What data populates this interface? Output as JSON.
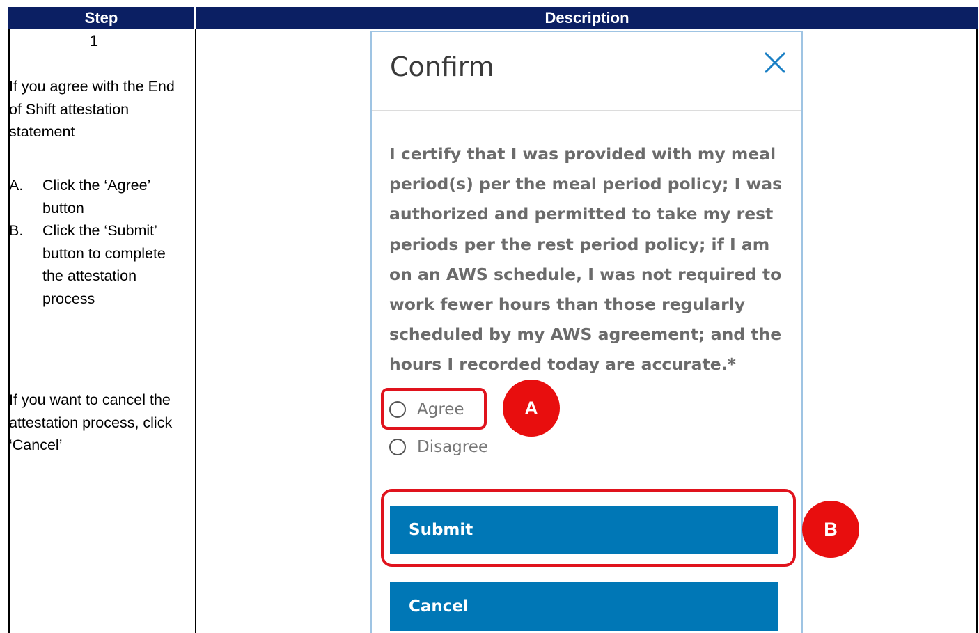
{
  "table": {
    "headers": {
      "step": "Step",
      "description": "Description"
    },
    "step_number": "1",
    "instructions": {
      "intro": "If you agree with the End of Shift attestation statement",
      "items": [
        {
          "letter": "A.",
          "text": "Click the ‘Agree’ button"
        },
        {
          "letter": "B.",
          "text": "Click the ‘Submit’ button to complete the attestation process"
        }
      ],
      "cancel_note": "If you want to cancel the attestation process, click ‘Cancel’"
    }
  },
  "modal": {
    "title": "Confirm",
    "statement": "I certify that I was provided with my meal period(s) per the meal period policy; I was authorized and permitted to take my rest periods per the rest period policy; if I am on an AWS schedule, I was not required to work fewer hours than those regularly scheduled by my AWS agreement; and the hours I recorded today are accurate.*",
    "options": {
      "agree": "Agree",
      "disagree": "Disagree"
    },
    "submit_label": "Submit",
    "cancel_label": "Cancel"
  },
  "markers": {
    "a": "A",
    "b": "B"
  },
  "colors": {
    "header_bg": "#0b1f63",
    "button_bg": "#0077b6",
    "highlight": "#e0131d",
    "modal_border": "#9fc4e3",
    "statement_text": "#6b6b6b"
  }
}
